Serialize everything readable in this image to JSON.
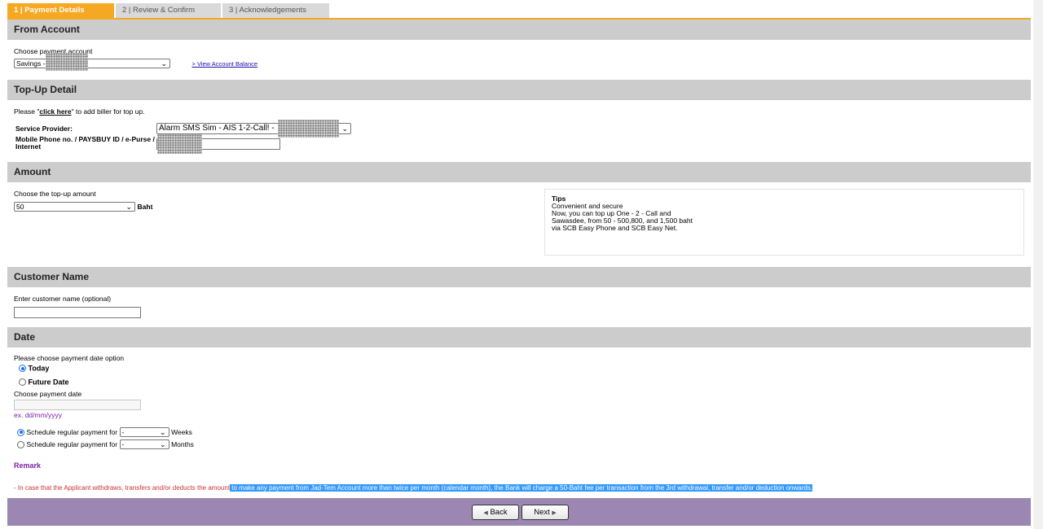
{
  "tabs": [
    {
      "label": "1 | Payment Details",
      "active": true
    },
    {
      "label": "2 | Review & Confirm",
      "active": false
    },
    {
      "label": "3 | Acknowledgements",
      "active": false
    }
  ],
  "from_account": {
    "header": "From Account",
    "choose_label": "Choose payment account",
    "selected_account": "Savings -",
    "view_balance_link": "> View Account Balance"
  },
  "topup": {
    "header": "Top-Up Detail",
    "add_biller_prefix": "Please \"",
    "add_biller_link": "click here",
    "add_biller_suffix": "\" to add biller for top up.",
    "service_provider_label": "Service Provider:",
    "service_provider_value": "Alarm SMS Sim - AIS 1-2-Call! -",
    "mobile_label_line1": "Mobile Phone no. / PAYSBUY ID / e-Purse /",
    "mobile_label_line2": "Internet"
  },
  "amount": {
    "header": "Amount",
    "choose_label": "Choose the top-up amount",
    "selected_amount": "50",
    "currency": "Baht",
    "tips": {
      "title": "Tips",
      "lines": [
        "Convenient and secure",
        "Now, you can top up One - 2 - Call and",
        "Sawasdee, from 50 - 500,800, and 1,500 baht",
        "via SCB Easy Phone and SCB Easy Net."
      ]
    }
  },
  "customer": {
    "header": "Customer Name",
    "enter_label": "Enter customer name (optional)",
    "name_value": ""
  },
  "date": {
    "header": "Date",
    "option_label": "Please choose payment date option",
    "today_label": "Today",
    "future_label": "Future Date",
    "choose_date_label": "Choose payment date",
    "date_format_hint": "ex. dd/mm/yyyy",
    "schedule_weeks_label": "Schedule regular payment for",
    "schedule_weeks_value": "-",
    "weeks_unit": "Weeks",
    "schedule_months_label": "Schedule regular payment for",
    "schedule_months_value": "-",
    "months_unit": "Months"
  },
  "remark": {
    "title": "Remark",
    "text_plain": "- In case that the Applicant withdraws, transfers and/or deducts the amount",
    "text_highlighted": " to make any payment from Jad-Tem Account more than twice per month (calendar month), the Bank will charge a 50-Baht fee per transaction from the 3rd withdrawal, transfer and/or deduction onwards."
  },
  "buttons": {
    "back_label": "Back",
    "next_label": "Next"
  },
  "colors": {
    "active_tab": "#f7a823",
    "section_header": "#cccccc",
    "footer_bar": "#9b87b2",
    "remark_title": "#7b1fa2",
    "remark_text": "#cc3333",
    "highlight": "#3399ff"
  },
  "icons": {
    "dropdown": "chevron-down-icon",
    "back": "triangle-left-icon",
    "next": "triangle-right-icon"
  }
}
